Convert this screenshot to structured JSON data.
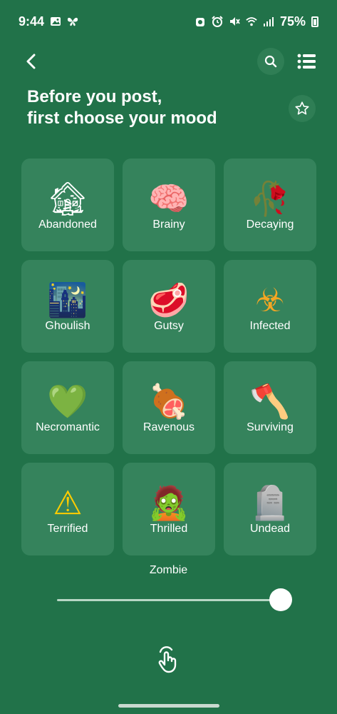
{
  "status_bar": {
    "time": "9:44",
    "battery": "75%",
    "icons_left": [
      "gallery-icon",
      "butterfly-icon"
    ],
    "icons_right": [
      "cleaner-icon",
      "alarm-icon",
      "mute-icon",
      "wifi-icon",
      "signal-icon",
      "battery-icon"
    ]
  },
  "nav": {
    "back_icon": "chevron-left-icon",
    "search_icon": "search-icon",
    "menu_icon": "list-menu-icon"
  },
  "header": {
    "line1": "Before you post,",
    "line2": "first choose your mood",
    "favorite_icon": "star-outline-icon"
  },
  "moods": [
    {
      "emoji": "🏚",
      "label": "Abandoned"
    },
    {
      "emoji": "🧠",
      "label": "Brainy"
    },
    {
      "emoji": "🥀",
      "label": "Decaying"
    },
    {
      "emoji": "🌃",
      "label": "Ghoulish"
    },
    {
      "emoji": "🥩",
      "label": "Gutsy"
    },
    {
      "emoji": "☣",
      "label": "Infected"
    },
    {
      "emoji": "💚",
      "label": "Necromantic"
    },
    {
      "emoji": "🍖",
      "label": "Ravenous"
    },
    {
      "emoji": "🪓",
      "label": "Surviving"
    },
    {
      "emoji": "⚠",
      "label": "Terrified"
    },
    {
      "emoji": "🧟",
      "label": "Thrilled"
    },
    {
      "emoji": "🪦",
      "label": "Undead"
    }
  ],
  "theme_slider": {
    "label": "Zombie",
    "value_fraction": 0.95
  },
  "gesture_icon": "hand-tap-icon",
  "colors": {
    "background": "#217249",
    "tile": "#35835c",
    "text": "#ffffff"
  }
}
